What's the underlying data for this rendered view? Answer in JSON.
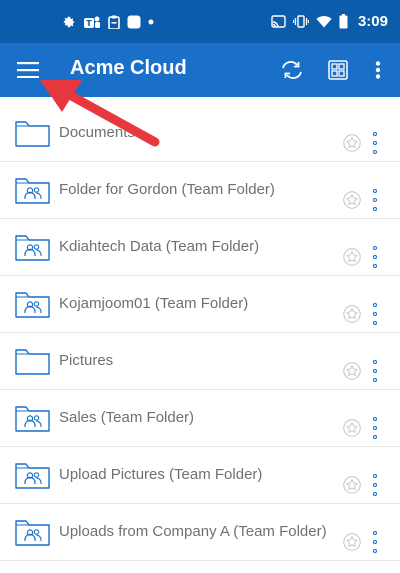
{
  "status_bar": {
    "time": "3:09",
    "icons": [
      "gear-icon",
      "teams-icon",
      "clipboard-icon",
      "square-icon",
      "dot-icon",
      "cast-icon",
      "vibrate-icon",
      "wifi-icon",
      "battery-icon"
    ]
  },
  "app_bar": {
    "title": "Acme Cloud",
    "icons": [
      "hamburger-menu-icon",
      "sync-icon",
      "grid-view-icon",
      "more-vert-icon"
    ]
  },
  "folders": [
    {
      "name": "Documents",
      "type": "folder"
    },
    {
      "name": "Folder for Gordon (Team Folder)",
      "type": "team-folder"
    },
    {
      "name": "Kdiahtech Data (Team Folder)",
      "type": "team-folder"
    },
    {
      "name": "Kojamjoom01 (Team Folder)",
      "type": "team-folder"
    },
    {
      "name": "Pictures",
      "type": "folder"
    },
    {
      "name": "Sales (Team Folder)",
      "type": "team-folder"
    },
    {
      "name": "Upload Pictures (Team Folder)",
      "type": "team-folder"
    },
    {
      "name": "Uploads from Company A (Team Folder)",
      "type": "team-folder"
    }
  ],
  "colors": {
    "status_bar": "#0b5cab",
    "app_bar": "#1a6fc9",
    "folder_icon": "#1a6fc9",
    "text": "#6c7174",
    "annotation_arrow": "#e8383f"
  }
}
